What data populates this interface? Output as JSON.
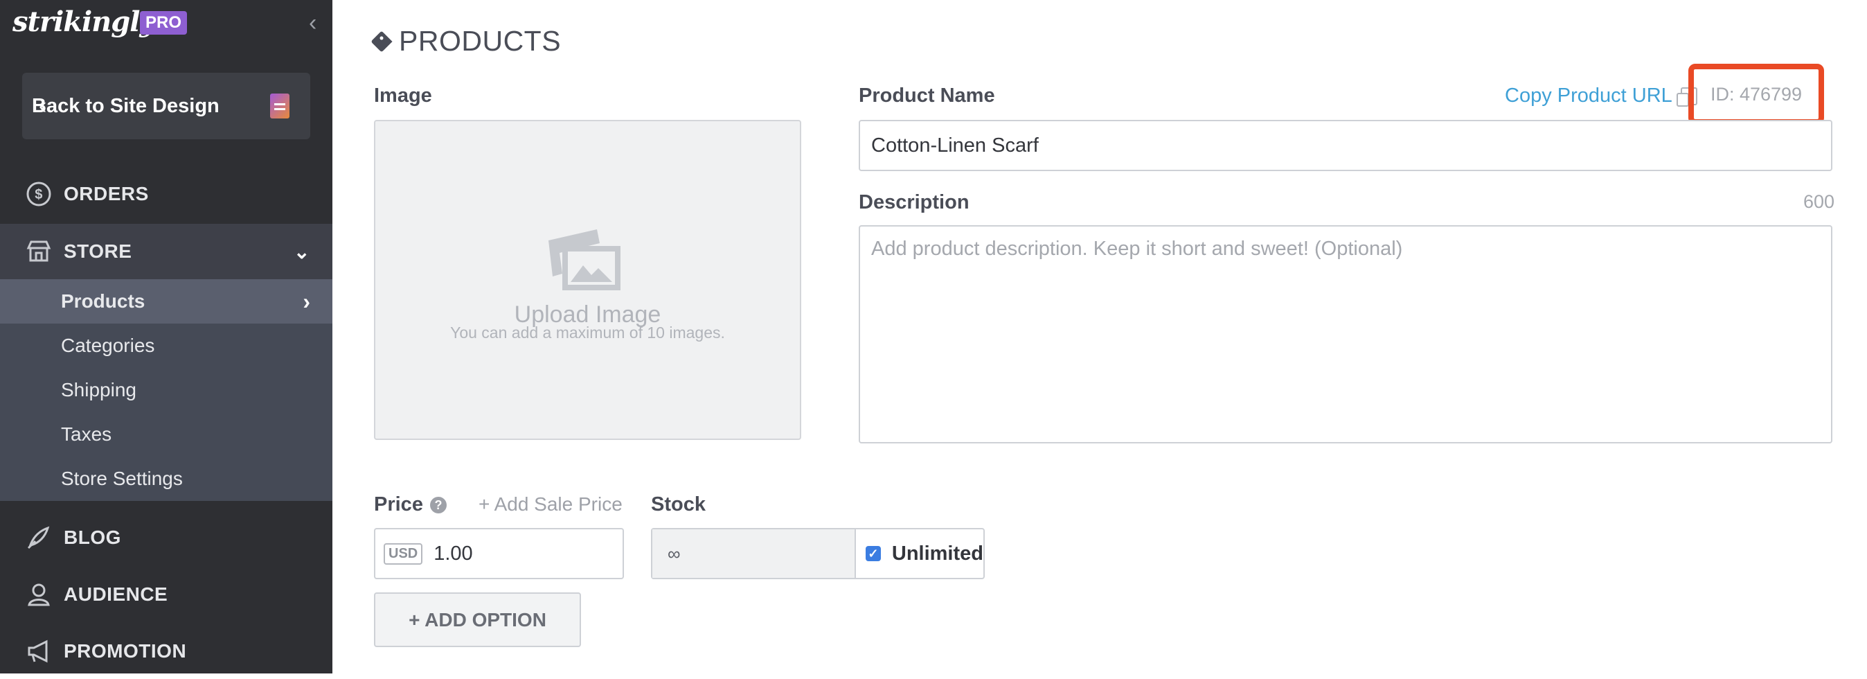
{
  "sidebar": {
    "logo": "strikingly",
    "badge": "PRO",
    "collapse_icon": "‹",
    "back_label": "Back to Site Design",
    "nav": {
      "orders": "ORDERS",
      "store": "STORE",
      "blog": "BLOG",
      "audience": "AUDIENCE",
      "promotion": "PROMOTION"
    },
    "store_items": [
      "Products",
      "Categories",
      "Shipping",
      "Taxes",
      "Store Settings"
    ]
  },
  "main": {
    "title": "PRODUCTS",
    "image_label": "Image",
    "upload_title": "Upload Image",
    "upload_sub": "You can add a maximum of 10 images.",
    "name_label": "Product Name",
    "copy_url": "Copy Product URL",
    "product_id": "ID: 476799",
    "name_value": "Cotton-Linen Scarf",
    "desc_label": "Description",
    "desc_counter": "600",
    "desc_placeholder": "Add product description. Keep it short and sweet! (Optional)",
    "price_label": "Price",
    "add_sale": "+ Add Sale Price",
    "currency": "USD",
    "price_value": "1.00",
    "stock_label": "Stock",
    "stock_value": "∞",
    "unlimited": "Unlimited",
    "add_option": "+ ADD OPTION"
  },
  "colors": {
    "accent": "#3fa0d6",
    "highlight": "#e94a25",
    "sidebar": "#2e2f33",
    "badge": "#8e5fd1"
  }
}
